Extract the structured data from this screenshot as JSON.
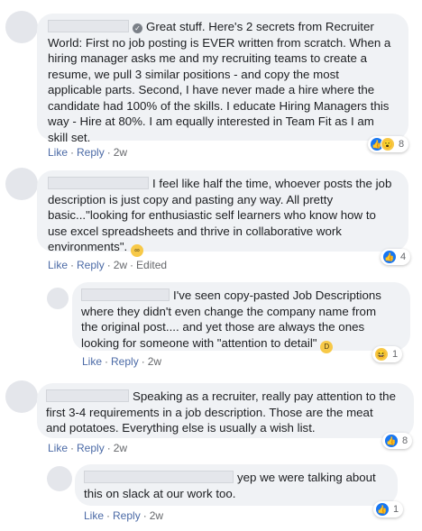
{
  "comments": [
    {
      "lines": [
        "Great stuff. Here's 2 secrets from Recruiter",
        "World: First no job posting is EVER written from scratch. When a",
        "hiring manager asks me and my recruiting teams to create a",
        "resume, we pull 3 similar positions - and copy the most",
        "applicable parts. Second, I have never made a hire where the",
        "candidate had 100% of the skills. I educate Hiring Managers this",
        "way - Hire at 80%. I am equally interested in Team Fit as I am",
        "skill set."
      ],
      "like": "Like",
      "reply": "Reply",
      "time": "2w",
      "reaction_icons": [
        "like-icon",
        "wow-icon"
      ],
      "reaction_count": "8"
    },
    {
      "lines": [
        "I feel like half the time, whoever posts the job",
        "description is just copy and pasting any way. All pretty",
        "basic...\"looking for enthusiastic self learners who know how to",
        "use excel spreadsheets and thrive in collaborative work",
        "environments\"."
      ],
      "like": "Like",
      "reply": "Reply",
      "time": "2w",
      "edited": "Edited",
      "reaction_icons": [
        "like-icon"
      ],
      "reaction_count": "4"
    },
    {
      "lines": [
        "I've seen copy-pasted Job Descriptions",
        "where they didn't even change the company name from",
        "the original post.... and yet those are always the ones",
        "looking for someone with \"attention to detail\""
      ],
      "like": "Like",
      "reply": "Reply",
      "time": "2w",
      "reaction_icons": [
        "haha-icon"
      ],
      "reaction_count": "1"
    },
    {
      "lines": [
        "Speaking as a recruiter, really pay attention to the",
        "first 3-4 requirements in a job description. Those are the meat",
        "and potatoes. Everything else is usually a wish list."
      ],
      "like": "Like",
      "reply": "Reply",
      "time": "2w",
      "reaction_icons": [
        "like-icon"
      ],
      "reaction_count": "8"
    },
    {
      "lines": [
        "yep we were talking about",
        "this on slack at our work too."
      ],
      "like": "Like",
      "reply": "Reply",
      "time": "2w",
      "reaction_icons": [
        "like-icon"
      ],
      "reaction_count": "1"
    }
  ],
  "colors": {
    "link": "#4b6aa6",
    "meta": "#65676b",
    "bubble": "#f0f2f5",
    "like_blue": "#1877f2"
  }
}
